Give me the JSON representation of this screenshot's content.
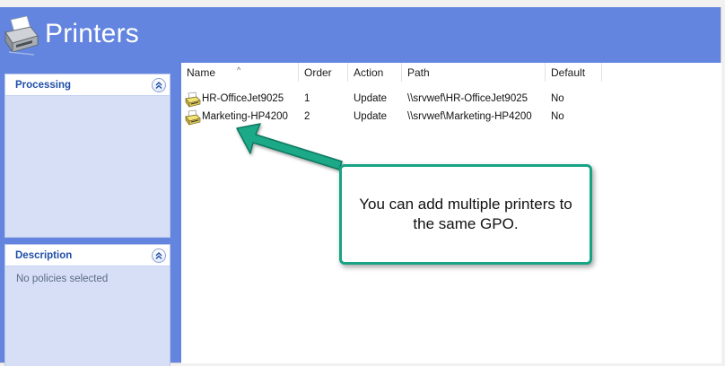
{
  "header": {
    "title": "Printers",
    "icon": "printer-icon"
  },
  "panels": {
    "processing": {
      "title": "Processing"
    },
    "description": {
      "title": "Description",
      "text": "No policies selected"
    }
  },
  "table": {
    "columns": [
      "Name",
      "Order",
      "Action",
      "Path",
      "Default"
    ],
    "rows": [
      {
        "name": "HR-OfficeJet9025",
        "order": "1",
        "action": "Update",
        "path": "\\\\srvwef\\HR-OfficeJet9025",
        "default": "No"
      },
      {
        "name": "Marketing-HP4200",
        "order": "2",
        "action": "Update",
        "path": "\\\\srvwef\\Marketing-HP4200",
        "default": "No"
      }
    ]
  },
  "callout": {
    "text": "You can add multiple printers to the same GPO."
  },
  "colors": {
    "header_bg": "#6384df",
    "panel_bg": "#d6dff5",
    "panel_title": "#1f4fa8",
    "callout_border": "#18a384"
  }
}
